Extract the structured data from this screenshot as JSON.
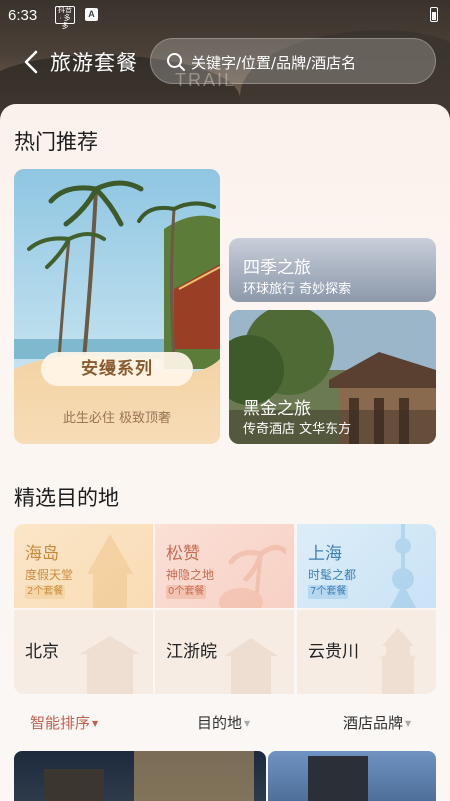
{
  "status_bar": {
    "time": "6:33",
    "icon_label": "抖音 · 多多",
    "notif_letter": "A"
  },
  "header": {
    "back_icon": "chevron-left-icon",
    "title": "旅游套餐",
    "background_sign": "TRAIL",
    "search": {
      "icon": "search-icon",
      "placeholder": "关键字/位置/品牌/酒店名"
    }
  },
  "hot": {
    "title": "热门推荐",
    "featured": {
      "label": "安缦系列",
      "subtitle": "此生必住 极致顶奢"
    },
    "cards": [
      {
        "title": "四季之旅",
        "subtitle": "环球旅行 奇妙探索"
      },
      {
        "title": "黑金之旅",
        "subtitle": "传奇酒店 文华东方"
      }
    ]
  },
  "destinations": {
    "title": "精选目的地",
    "featured": [
      {
        "name": "海岛",
        "tagline": "度假天堂",
        "badge": "2个套餐",
        "color": "#c98a3e"
      },
      {
        "name": "松赞",
        "tagline": "神隐之地",
        "badge": "0个套餐",
        "color": "#c76c52"
      },
      {
        "name": "上海",
        "tagline": "时髦之都",
        "badge": "7个套餐",
        "color": "#3d7fb4"
      }
    ],
    "others": [
      {
        "name": "北京"
      },
      {
        "name": "江浙皖"
      },
      {
        "name": "云贵川"
      }
    ]
  },
  "filters": [
    {
      "label": "智能排序",
      "active": true,
      "color": "#c0604e"
    },
    {
      "label": "目的地",
      "active": false
    },
    {
      "label": "酒店品牌",
      "active": false
    }
  ]
}
